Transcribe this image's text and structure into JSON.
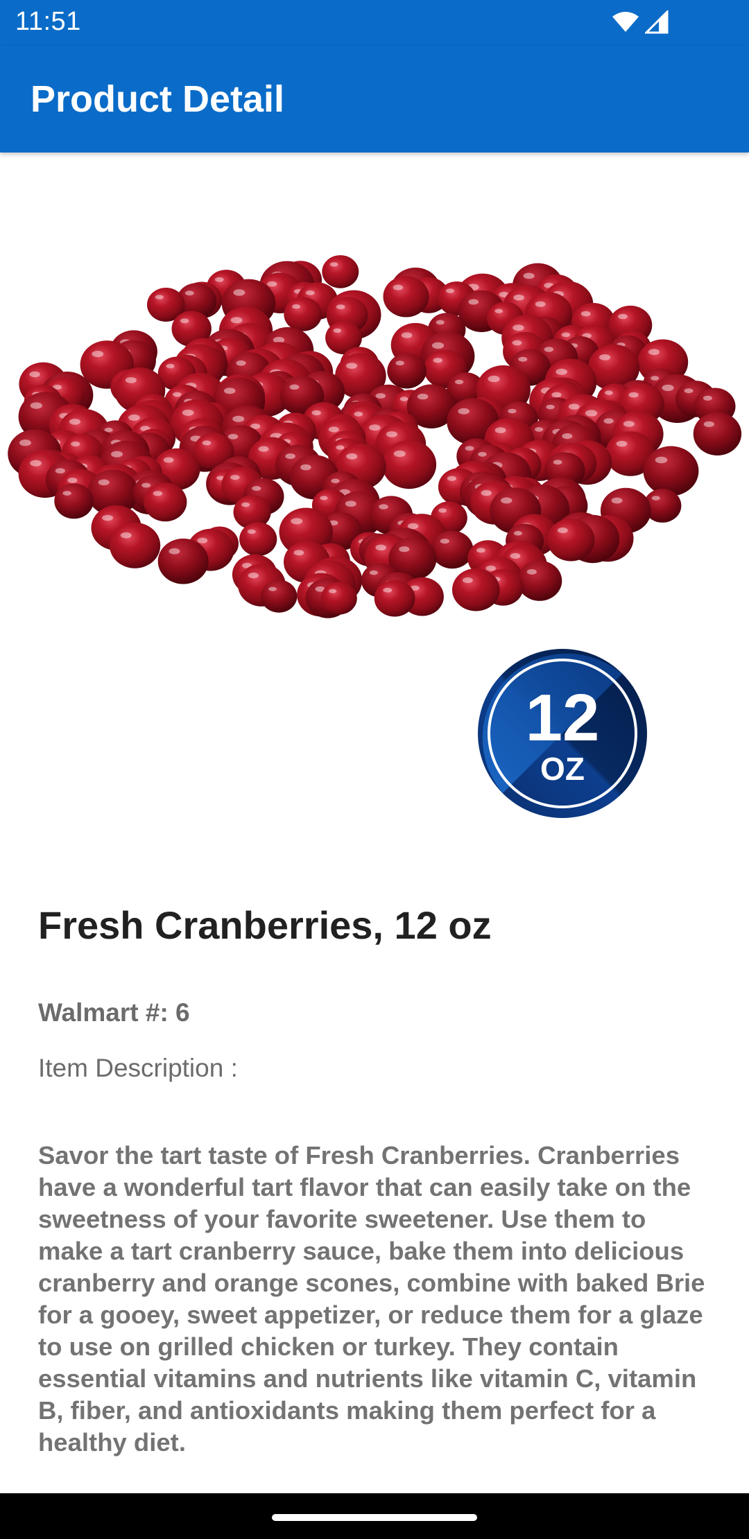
{
  "status_bar": {
    "time": "11:51",
    "icons": [
      "wifi-icon",
      "cellular-signal-icon"
    ]
  },
  "app_bar": {
    "title": "Product Detail",
    "color": "#0a6cc8"
  },
  "product": {
    "image_icon": "cranberries-product-image",
    "size_badge": {
      "number": "12",
      "unit": "OZ"
    },
    "title": "Fresh Cranberries, 12 oz",
    "walmart_number": "Walmart #: 6",
    "description_label": "Item Description :",
    "description": "Savor the tart taste of Fresh Cranberries. Cranberries have a wonderful tart flavor that can easily take on the sweetness of your favorite sweetener. Use them to make a tart cranberry sauce, bake them into delicious cranberry and orange scones, combine with baked Brie for a gooey, sweet appetizer, or reduce them for a glaze to use on grilled chicken or turkey. They contain essential vitamins and nutrients like vitamin C, vitamin B, fiber, and antioxidants making them perfect for a healthy diet."
  },
  "colors": {
    "primary": "#0a6cc8",
    "title_text": "#212121",
    "secondary_text": "#6b6b6b",
    "cranberry": "#a3101c"
  }
}
